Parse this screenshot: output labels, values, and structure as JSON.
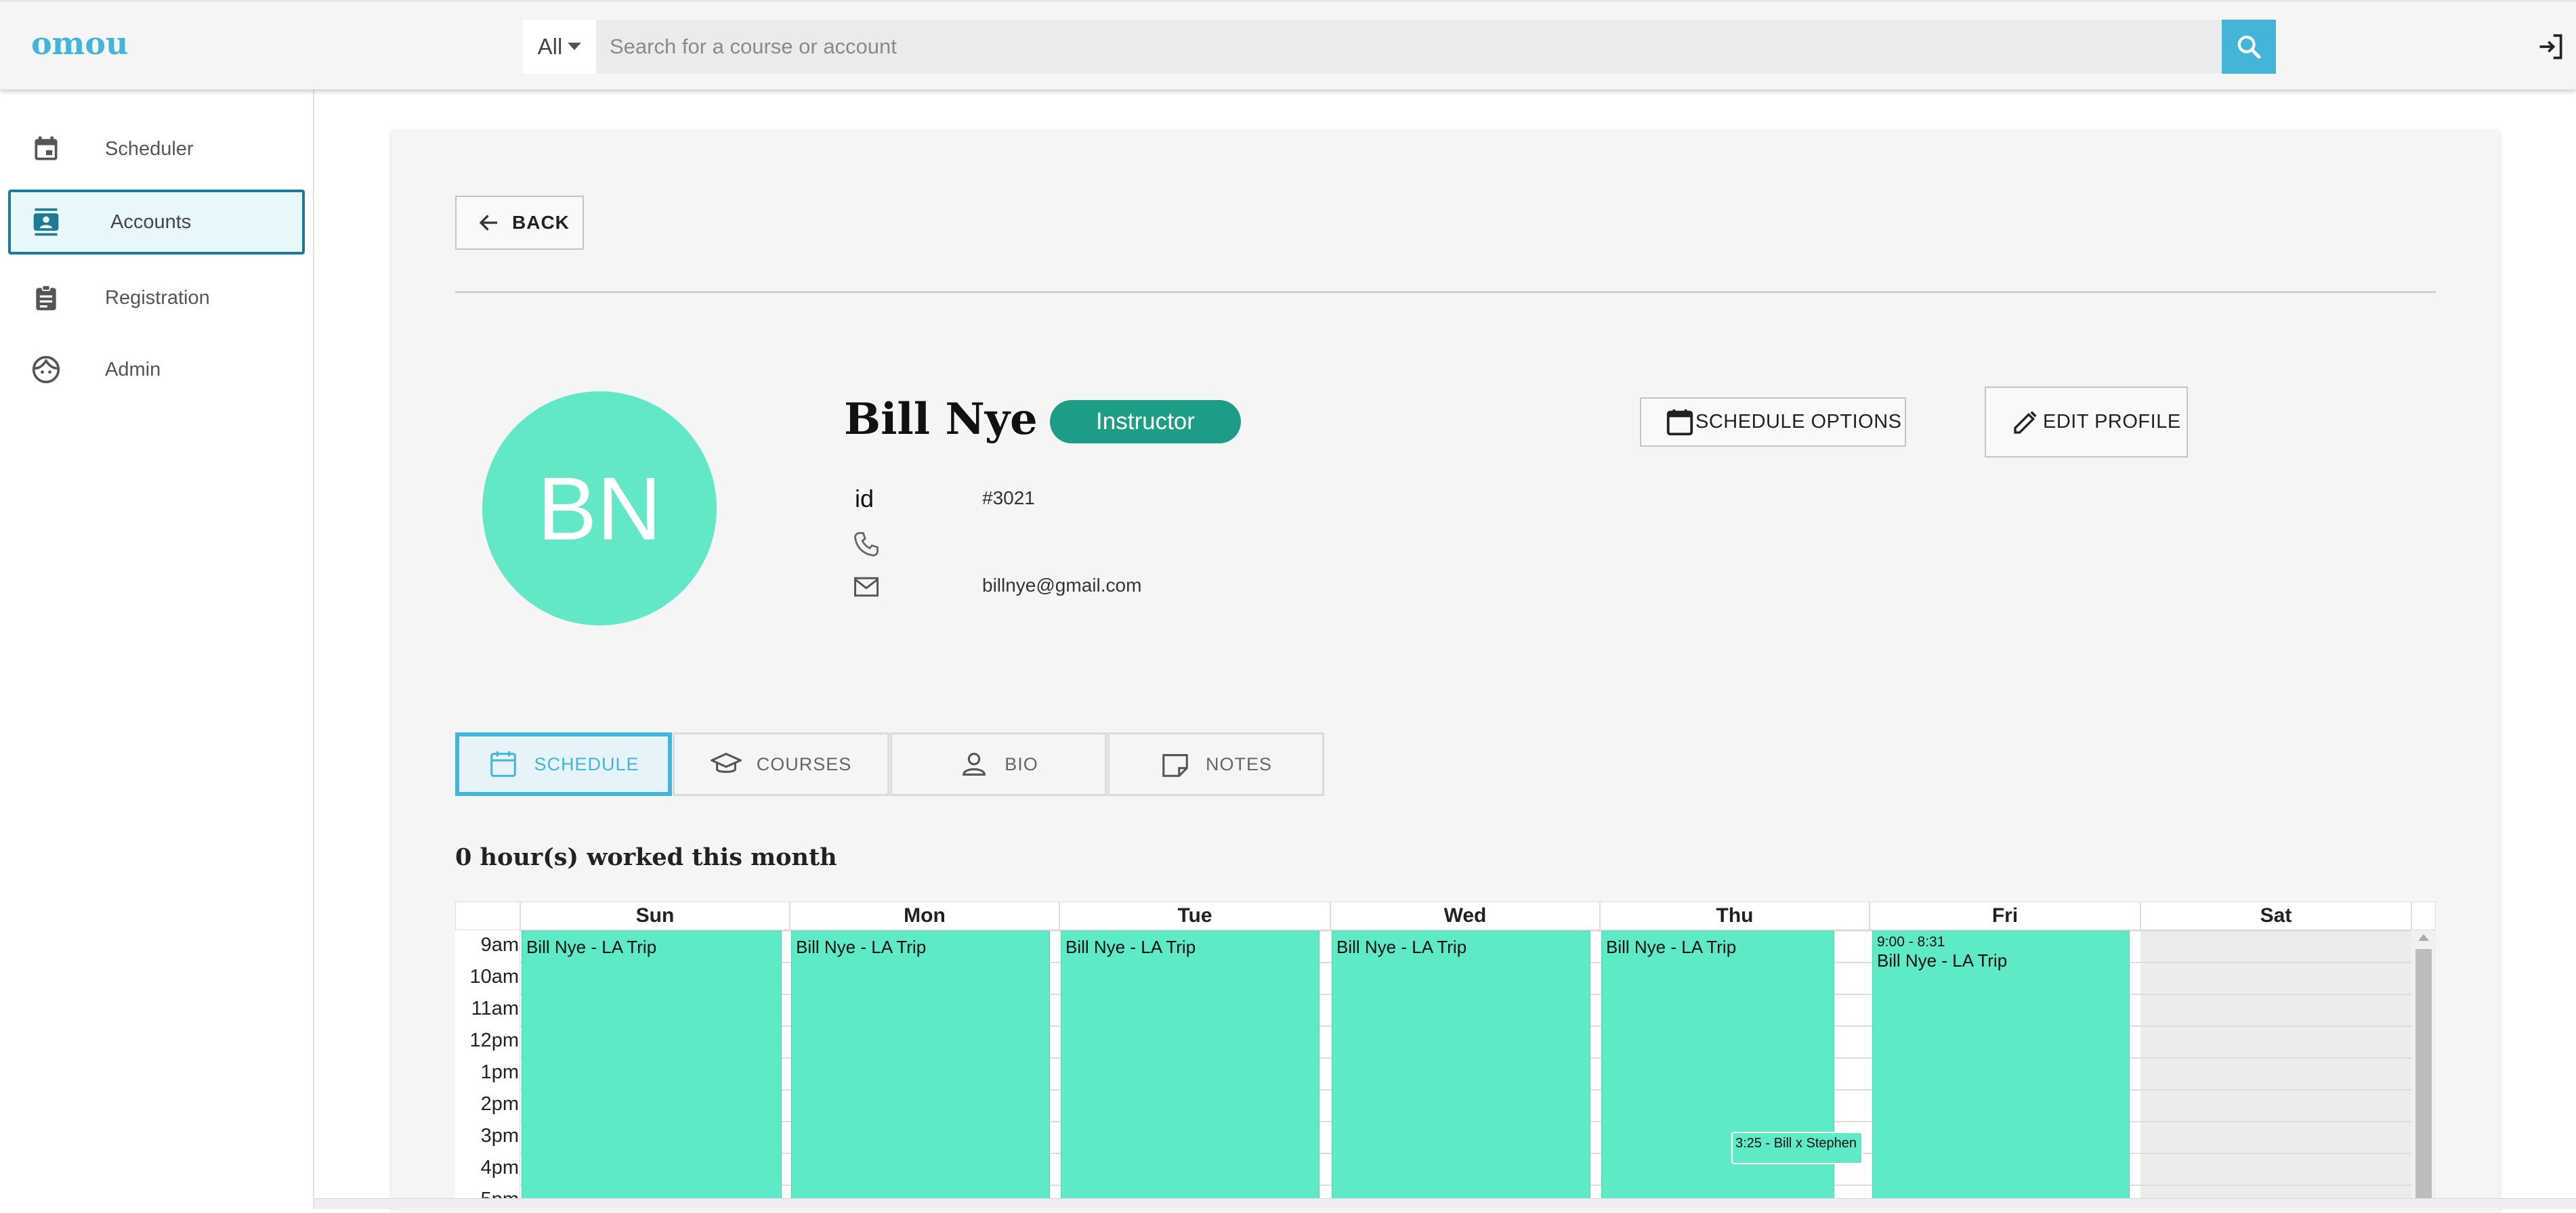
{
  "app": {
    "logo": "omou"
  },
  "search": {
    "scope": "All",
    "placeholder": "Search for a course or account"
  },
  "sidebar": {
    "items": [
      {
        "label": "Scheduler",
        "icon": "calendar-icon",
        "active": false
      },
      {
        "label": "Accounts",
        "icon": "contacts-icon",
        "active": true
      },
      {
        "label": "Registration",
        "icon": "clipboard-icon",
        "active": false
      },
      {
        "label": "Admin",
        "icon": "face-icon",
        "active": false
      }
    ]
  },
  "profile": {
    "back_label": "BACK",
    "initials": "BN",
    "name": "Bill Nye",
    "role": "Instructor",
    "id_label": "id",
    "id_value": "#3021",
    "phone": "",
    "email": "billnye@gmail.com",
    "schedule_options_label": "SCHEDULE OPTIONS",
    "edit_profile_label": "EDIT PROFILE"
  },
  "tabs": [
    {
      "label": "SCHEDULE",
      "icon": "calendar-icon",
      "active": true
    },
    {
      "label": "COURSES",
      "icon": "graduation-cap-icon",
      "active": false
    },
    {
      "label": "BIO",
      "icon": "person-icon",
      "active": false
    },
    {
      "label": "NOTES",
      "icon": "note-icon",
      "active": false
    }
  ],
  "schedule": {
    "hours_summary": "0 hour(s) worked this month",
    "days": [
      "Sun",
      "Mon",
      "Tue",
      "Wed",
      "Thu",
      "Fri",
      "Sat"
    ],
    "times": [
      "9am",
      "10am",
      "11am",
      "12pm",
      "1pm",
      "2pm",
      "3pm",
      "4pm",
      "5pm"
    ],
    "events": [
      {
        "day": "Sun",
        "title": "Bill Nye - LA Trip"
      },
      {
        "day": "Mon",
        "title": "Bill Nye - LA Trip"
      },
      {
        "day": "Tue",
        "title": "Bill Nye - LA Trip"
      },
      {
        "day": "Wed",
        "title": "Bill Nye - LA Trip"
      },
      {
        "day": "Thu",
        "title": "Bill Nye - LA Trip"
      },
      {
        "day": "Fri",
        "title": "Bill Nye - LA Trip",
        "time": "9:00 - 8:31"
      }
    ],
    "small_event": {
      "day": "Thu",
      "label": "3:25 - Bill x Stephen"
    }
  },
  "colors": {
    "accent": "#43b5d9",
    "event": "#5ee9c7",
    "avatar": "#62e8c6",
    "badge": "#1d9d85",
    "active_nav_border": "#1f7a94"
  }
}
